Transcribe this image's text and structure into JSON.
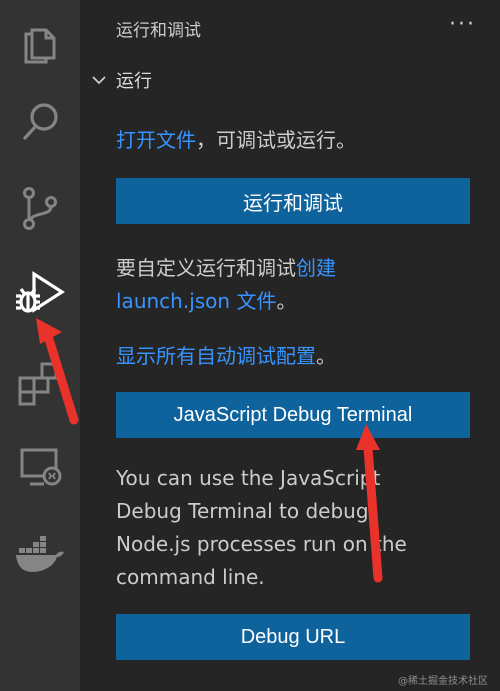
{
  "activity_bar": {
    "icons": [
      "explorer-icon",
      "search-icon",
      "source-control-icon",
      "run-debug-icon",
      "extensions-icon",
      "remote-explorer-icon",
      "docker-icon"
    ]
  },
  "sidebar": {
    "title": "运行和调试",
    "more": "···",
    "section": {
      "title": "运行",
      "open_file_link": "打开文件",
      "open_file_rest": "，可调试或运行。",
      "run_debug_button": "运行和调试",
      "customize_text": "要自定义运行和调试",
      "create_link": "创建",
      "launch_link": "launch.json 文件",
      "launch_rest": "。",
      "show_all_link": "显示所有自动调试配置",
      "show_all_rest": "。",
      "js_debug_button": "JavaScript Debug Terminal",
      "js_desc": "You can use the JavaScript Debug Terminal to debug Node.js processes run on the command line.",
      "debug_url_button": "Debug URL"
    }
  },
  "watermark": "@稀土掘金技术社区",
  "colors": {
    "accent_link": "#3794ff",
    "button_bg": "#0e639c",
    "annotation_arrow": "#e8322a"
  }
}
